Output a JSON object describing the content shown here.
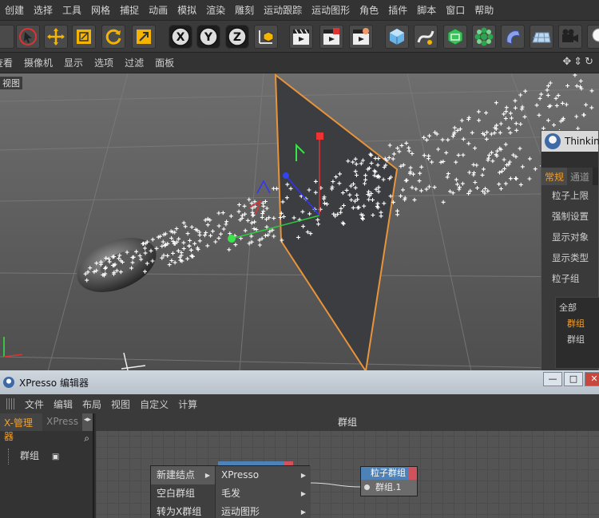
{
  "menu": [
    "创建",
    "选择",
    "工具",
    "网格",
    "捕捉",
    "动画",
    "模拟",
    "渲染",
    "雕刻",
    "运动跟踪",
    "运动图形",
    "角色",
    "插件",
    "脚本",
    "窗口",
    "帮助"
  ],
  "view_menu": [
    "查看",
    "摄像机",
    "显示",
    "选项",
    "过滤",
    "面板"
  ],
  "viewport_label": "视图",
  "axis_buttons": {
    "x": "X",
    "y": "Y",
    "z": "Z"
  },
  "thinking": {
    "title": "Thinking",
    "tabs": [
      "常规",
      "通道"
    ],
    "fields": [
      "粒子上限",
      "强制设置",
      "显示对象",
      "显示类型"
    ],
    "group_label": "粒子组",
    "tree": [
      "全部",
      "群组",
      "群组"
    ]
  },
  "xpresso": {
    "title": "XPresso 编辑器",
    "menu": [
      "文件",
      "编辑",
      "布局",
      "视图",
      "自定义",
      "计算"
    ],
    "left_tabs": [
      "X-管理器",
      "XPress"
    ],
    "left_tree_item": "群组",
    "canvas_title": "群组",
    "node": {
      "title": "粒子群组",
      "port": "群组.1"
    },
    "context_menu": {
      "col1": [
        "新建结点",
        "空白群组",
        "转为X群组"
      ],
      "col2": [
        "XPresso",
        "毛发",
        "运动图形"
      ]
    }
  },
  "colors": {
    "accent": "#f0a030",
    "node_header": "#4d82b8",
    "node_red": "#d0525d",
    "selected_outline": "#e8943a"
  }
}
